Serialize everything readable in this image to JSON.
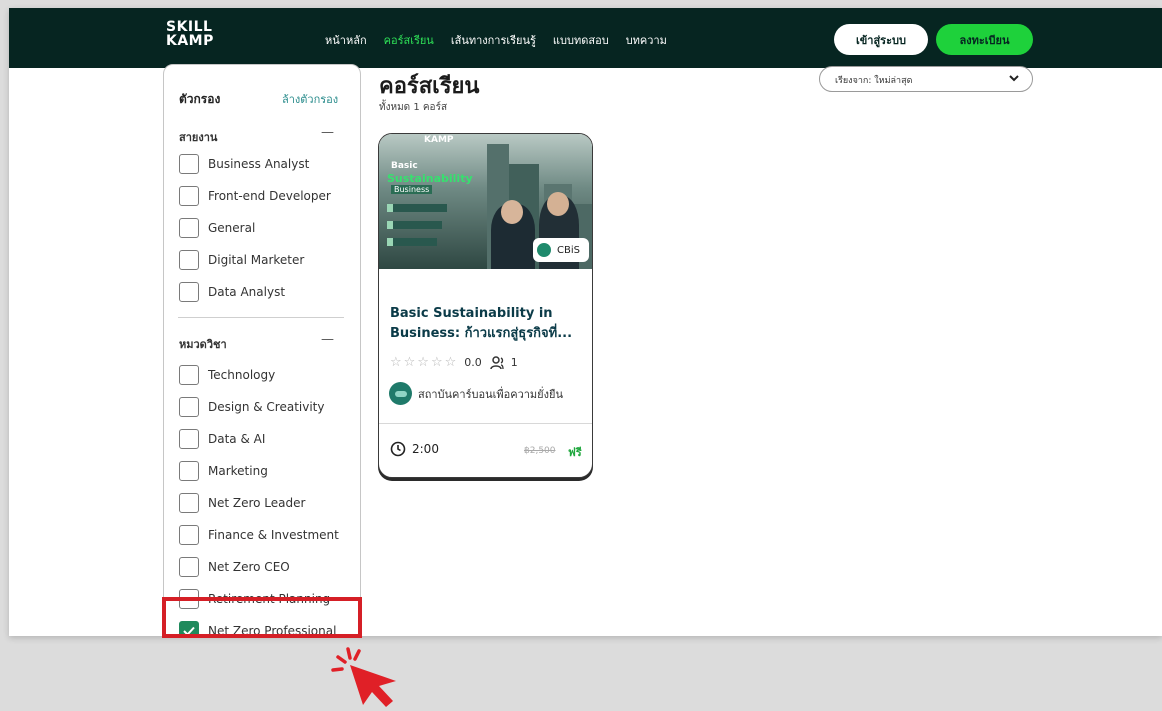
{
  "nav": {
    "logo_top": "SKILL",
    "logo_bottom": "KAMP",
    "links": [
      "หน้าหลัก",
      "คอร์สเรียน",
      "เส้นทางการเรียนรู้",
      "แบบทดสอบ",
      "บทความ"
    ],
    "active_index": 1,
    "login_label": "เข้าสู่ระบบ",
    "register_label": "ลงทะเบียน"
  },
  "sidebar": {
    "title": "ตัวกรอง",
    "clear_label": "ล้างตัวกรอง",
    "groups": [
      {
        "title": "สายงาน",
        "collapse_symbol": "—",
        "options": [
          {
            "label": "Business Analyst",
            "checked": false
          },
          {
            "label": "Front-end Developer",
            "checked": false
          },
          {
            "label": "General",
            "checked": false
          },
          {
            "label": "Digital Marketer",
            "checked": false
          },
          {
            "label": "Data Analyst",
            "checked": false
          }
        ]
      },
      {
        "title": "หมวดวิชา",
        "collapse_symbol": "—",
        "options": [
          {
            "label": "Technology",
            "checked": false
          },
          {
            "label": "Design & Creativity",
            "checked": false
          },
          {
            "label": "Data & AI",
            "checked": false
          },
          {
            "label": "Marketing",
            "checked": false
          },
          {
            "label": "Net Zero Leader",
            "checked": false
          },
          {
            "label": "Finance & Investment",
            "checked": false
          },
          {
            "label": "Net Zero CEO",
            "checked": false
          },
          {
            "label": "Retirement Planning",
            "checked": false
          },
          {
            "label": "Net Zero Professional",
            "checked": true
          }
        ]
      }
    ]
  },
  "main": {
    "title": "คอร์สเรียน",
    "count": "ทั้งหมด 1 คอร์ส",
    "sort_value": "เรียงจาก: ใหม่ล่าสุด"
  },
  "course": {
    "image_brand": "KAMP",
    "image_text_1": "Basic",
    "image_text_2": "Sustainability",
    "image_text_3": "Business",
    "badge": "CBiS",
    "title": "Basic Sustainability in Business: ก้าวแรกสู่ธุรกิจที่...",
    "rating": "0.0",
    "learners": "1",
    "institute": "สถาบันคาร์บอนเพื่อความยั่งยืน",
    "duration": "2:00",
    "old_price": "฿2,500",
    "price": "ฟรี"
  },
  "colors": {
    "nav_bg": "#062521",
    "accent_green": "#1ed13b",
    "highlight_red": "#d51f26",
    "title_blue": "#0b3b48"
  }
}
